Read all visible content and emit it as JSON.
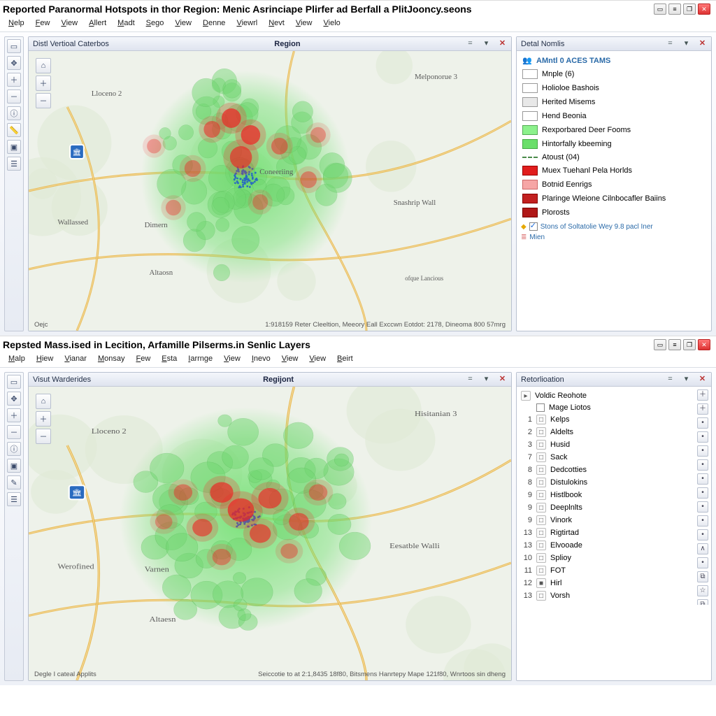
{
  "windows": [
    {
      "title": "Reported Paranormal Hotspots in thor Region: Menic Asrinciape Plirfer ad Berfall a PlitJooncy.seons",
      "menus": [
        "Nelp",
        "Few",
        "View",
        "Allert",
        "Madt",
        "Sego",
        "View",
        "Denne",
        "Viewrl",
        "Nevt",
        "View",
        "Vielo"
      ],
      "map_panel": {
        "left_title": "Distl Vertioal Caterbos",
        "center_title": "Region"
      },
      "map_labels": {
        "nw": "Lloceno 2",
        "ne": "Melponorue 3",
        "center": "Coneeriing",
        "w": "Wallassed",
        "wd": "Dimern",
        "sw": "Altaosn",
        "se": "Snashrip Wall",
        "se_small": "ofque Lancious"
      },
      "footer_left": "Oejc",
      "footer_right": "1:918159 Reter Cleeltion, Meeory Eall Exccwn Eotdot: 2178, Dineoma 800 57mrg",
      "legend": {
        "title": "Detal Nomlis",
        "header": "AMntl 0 ACES TAMS",
        "items_top": [
          {
            "swatch": "#ffffff",
            "border": "#999",
            "label": "Mnple (6)"
          },
          {
            "swatch": "#ffffff",
            "border": "#999",
            "label": "Holioloe Bashois"
          },
          {
            "swatch": "#e8e8e8",
            "border": "#999",
            "label": "Herited Misems"
          },
          {
            "swatch": "#ffffff",
            "border": "#999",
            "label": "Hend Beonia"
          },
          {
            "swatch": "#8cf18c",
            "border": "#5a5",
            "label": "Rexporbared Deer Fooms"
          },
          {
            "swatch": "#6adf6a",
            "border": "#4a4",
            "label": "Hintorfally kbeeming"
          }
        ],
        "divider_label": "Atoust (04)",
        "items_bot": [
          {
            "swatch": "#e11d1d",
            "border": "#900",
            "label": "Muex Tuehanl Pela Horlds"
          },
          {
            "swatch": "#f6a6a6",
            "border": "#c66",
            "label": "Botnid Eenrigs"
          },
          {
            "swatch": "#c22020",
            "border": "#800",
            "label": "Plaringe Wleione Cilnbocafler Baiins"
          },
          {
            "swatch": "#b01818",
            "border": "#700",
            "label": "Plorosts"
          }
        ],
        "footer1": "Stons of Soltatolie Wey 9.8 pacl Iner",
        "footer2": "Mien"
      }
    },
    {
      "title": "Repsted Mass.ised in Lecition, Arfamille Pilserms.in Senlic Layers",
      "menus": [
        "Malp",
        "Hiew",
        "Vianar",
        "Monsay",
        "Few",
        "Esta",
        "Iarrnge",
        "View",
        "Inevo",
        "View",
        "View",
        "Beirt"
      ],
      "map_panel": {
        "left_title": "Visut Warderides",
        "center_title": "Regijont"
      },
      "map_labels": {
        "nw": "Lloceno 2",
        "ne": "Hisitanian 3",
        "w": "Werofined",
        "wd": "Varnen",
        "sw": "Altaesn",
        "se": "Eesatble Walli"
      },
      "footer_left": "Degle   I cateal Applits",
      "footer_right": "Seiccotie to at 2:1,8435 18f80, Bitsmens Hanrtepy Mape 121f80, Wnrtoos sin dheng",
      "toc": {
        "title": "Retorlioation",
        "header": "Voldic Reohote",
        "first": "Mage Liotos",
        "rows": [
          {
            "n": "1",
            "label": "Kelps"
          },
          {
            "n": "2",
            "label": "Aldelts"
          },
          {
            "n": "3",
            "label": "Husid"
          },
          {
            "n": "7",
            "label": "Sack"
          },
          {
            "n": "8",
            "label": "Dedcotties"
          },
          {
            "n": "8",
            "label": "Distulokins"
          },
          {
            "n": "9",
            "label": "Histlbook"
          },
          {
            "n": "9",
            "label": "Deeplnlts"
          },
          {
            "n": "9",
            "label": "Vinork"
          },
          {
            "n": "13",
            "label": "Rigtirtad"
          },
          {
            "n": "13",
            "label": "Elvooade"
          },
          {
            "n": "10",
            "label": "Splioy"
          },
          {
            "n": "11",
            "label": "FOT"
          },
          {
            "n": "12",
            "label": "Hirl",
            "dark": true
          },
          {
            "n": "13",
            "label": "Vorsh"
          }
        ]
      }
    }
  ],
  "chart_data": {
    "type": "heatmap",
    "note": "density hotspot map — coordinates are relative % within map viewport; intensity 0..1",
    "hotspots_top": [
      {
        "x": 42,
        "y": 24,
        "r": 3.5,
        "intensity": 1.0
      },
      {
        "x": 46,
        "y": 30,
        "r": 3.5,
        "intensity": 1.0
      },
      {
        "x": 44,
        "y": 38,
        "r": 4.0,
        "intensity": 0.9
      },
      {
        "x": 38,
        "y": 28,
        "r": 3.0,
        "intensity": 0.7
      },
      {
        "x": 52,
        "y": 34,
        "r": 3.0,
        "intensity": 0.6
      },
      {
        "x": 34,
        "y": 42,
        "r": 3.0,
        "intensity": 0.5
      },
      {
        "x": 58,
        "y": 46,
        "r": 3.0,
        "intensity": 0.5
      },
      {
        "x": 30,
        "y": 56,
        "r": 2.8,
        "intensity": 0.4
      },
      {
        "x": 48,
        "y": 54,
        "r": 2.8,
        "intensity": 0.4
      },
      {
        "x": 60,
        "y": 30,
        "r": 2.8,
        "intensity": 0.4
      },
      {
        "x": 26,
        "y": 34,
        "r": 2.6,
        "intensity": 0.35
      }
    ],
    "hotspots_bottom": [
      {
        "x": 44,
        "y": 42,
        "r": 4.0,
        "intensity": 1.0
      },
      {
        "x": 40,
        "y": 36,
        "r": 3.5,
        "intensity": 0.95
      },
      {
        "x": 50,
        "y": 38,
        "r": 3.5,
        "intensity": 0.9
      },
      {
        "x": 48,
        "y": 50,
        "r": 3.2,
        "intensity": 0.85
      },
      {
        "x": 36,
        "y": 48,
        "r": 3.0,
        "intensity": 0.8
      },
      {
        "x": 56,
        "y": 46,
        "r": 3.0,
        "intensity": 0.75
      },
      {
        "x": 32,
        "y": 36,
        "r": 2.8,
        "intensity": 0.55
      },
      {
        "x": 60,
        "y": 36,
        "r": 2.8,
        "intensity": 0.5
      },
      {
        "x": 40,
        "y": 58,
        "r": 2.8,
        "intensity": 0.5
      },
      {
        "x": 54,
        "y": 56,
        "r": 2.6,
        "intensity": 0.45
      },
      {
        "x": 28,
        "y": 46,
        "r": 2.6,
        "intensity": 0.4
      }
    ],
    "green_field_radius_pct": 38,
    "title": ""
  }
}
